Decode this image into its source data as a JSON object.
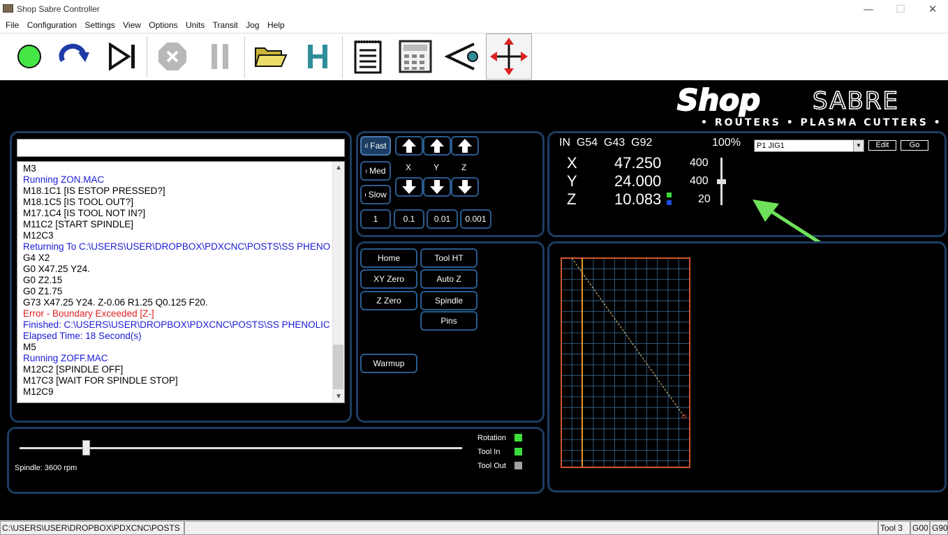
{
  "window": {
    "title": "Shop Sabre Controller",
    "minimize": "—",
    "maximize": "☐",
    "close": "✕"
  },
  "menu": [
    "File",
    "Configuration",
    "Settings",
    "View",
    "Options",
    "Units",
    "Transit",
    "Jog",
    "Help"
  ],
  "toolbar": {
    "icons": [
      "run-icon",
      "rewind-icon",
      "step-icon",
      "stop-icon",
      "pause-icon",
      "folder-icon",
      "home-h-icon",
      "notes-icon",
      "calculator-icon",
      "view-icon",
      "jog-icon"
    ]
  },
  "logo": {
    "brand_left": "Shop",
    "brand_right": "SABRE",
    "tagline": "• ROUTERS • PLASMA CUTTERS •"
  },
  "mdi": {
    "value": ""
  },
  "log": {
    "lines": [
      {
        "text": "M3",
        "color": "#000000"
      },
      {
        "text": "Running ZON.MAC",
        "color": "#1a1ad6"
      },
      {
        "text": "M18.1C1 [IS ESTOP PRESSED?]",
        "color": "#000000"
      },
      {
        "text": "M18.1C5 [IS TOOL OUT?]",
        "color": "#000000"
      },
      {
        "text": "M17.1C4 [IS TOOL NOT IN?]",
        "color": "#000000"
      },
      {
        "text": "M11C2 [START SPINDLE]",
        "color": "#000000"
      },
      {
        "text": "M12C3",
        "color": "#000000"
      },
      {
        "text": "Returning To C:\\USERS\\USER\\DROPBOX\\PDXCNC\\POSTS\\SS PHENOLIC",
        "color": "#1a1ad6"
      },
      {
        "text": "G4 X2",
        "color": "#000000"
      },
      {
        "text": "G0 X47.25 Y24.",
        "color": "#000000"
      },
      {
        "text": "G0 Z2.15",
        "color": "#000000"
      },
      {
        "text": "G0 Z1.75",
        "color": "#000000"
      },
      {
        "text": "G73 X47.25 Y24. Z-0.06 R1.25 Q0.125 F20.",
        "color": "#000000"
      },
      {
        "text": "Error - Boundary Exceeded [Z-]",
        "color": "#e02020"
      },
      {
        "text": "Finished: C:\\USERS\\USER\\DROPBOX\\PDXCNC\\POSTS\\SS PHENOLIC DO",
        "color": "#1a1ad6"
      },
      {
        "text": "Elapsed Time: 18 Second(s)",
        "color": "#1a1ad6"
      },
      {
        "text": "M5",
        "color": "#000000"
      },
      {
        "text": "Running ZOFF.MAC",
        "color": "#1a1ad6"
      },
      {
        "text": "M12C2 [SPINDLE OFF]",
        "color": "#000000"
      },
      {
        "text": "M17C3 [WAIT FOR SPINDLE STOP]",
        "color": "#000000"
      },
      {
        "text": "M12C9",
        "color": "#000000"
      }
    ]
  },
  "jog": {
    "speeds": [
      "Fast",
      "Med",
      "Slow"
    ],
    "axes": [
      "X",
      "Y",
      "Z"
    ],
    "steps": [
      "1",
      "0.1",
      "0.01",
      "0.001"
    ]
  },
  "actions": {
    "home": "Home",
    "tool_ht": "Tool HT",
    "xy_zero": "XY Zero",
    "auto_z": "Auto Z",
    "z_zero": "Z Zero",
    "spindle": "Spindle",
    "pins": "Pins",
    "warmup": "Warmup"
  },
  "dro": {
    "modes": "IN  G54  G43  G92",
    "override": "100%",
    "job_select": "P1 JIG1",
    "edit": "Edit",
    "go": "Go",
    "axes": [
      {
        "name": "X",
        "value": "47.250",
        "rate": "400"
      },
      {
        "name": "Y",
        "value": "24.000",
        "rate": "400"
      },
      {
        "name": "Z",
        "value": "10.083",
        "rate": "20"
      }
    ],
    "feed_level": 0.5
  },
  "spindle": {
    "label": "Spindle: 3600 rpm",
    "slider_level": 0.15
  },
  "indicators": [
    {
      "label": "Rotation",
      "color": "#3ddc3d"
    },
    {
      "label": "Tool In",
      "color": "#3ddc3d"
    },
    {
      "label": "Tool Out",
      "color": "#a0a0a0"
    }
  ],
  "statusbar": {
    "path": "C:\\USERS\\USER\\DROPBOX\\PDXCNC\\POSTS",
    "tool": "Tool 3",
    "g1": "G00",
    "g2": "G90"
  },
  "colors": {
    "panel_border": "#1c3d63",
    "button_border": "#2a5b8e",
    "annotation_arrow": "#6fe05a",
    "grid": "#3a6e9a",
    "boundary": "#d2552d",
    "toolpath": "#e8c98a"
  }
}
